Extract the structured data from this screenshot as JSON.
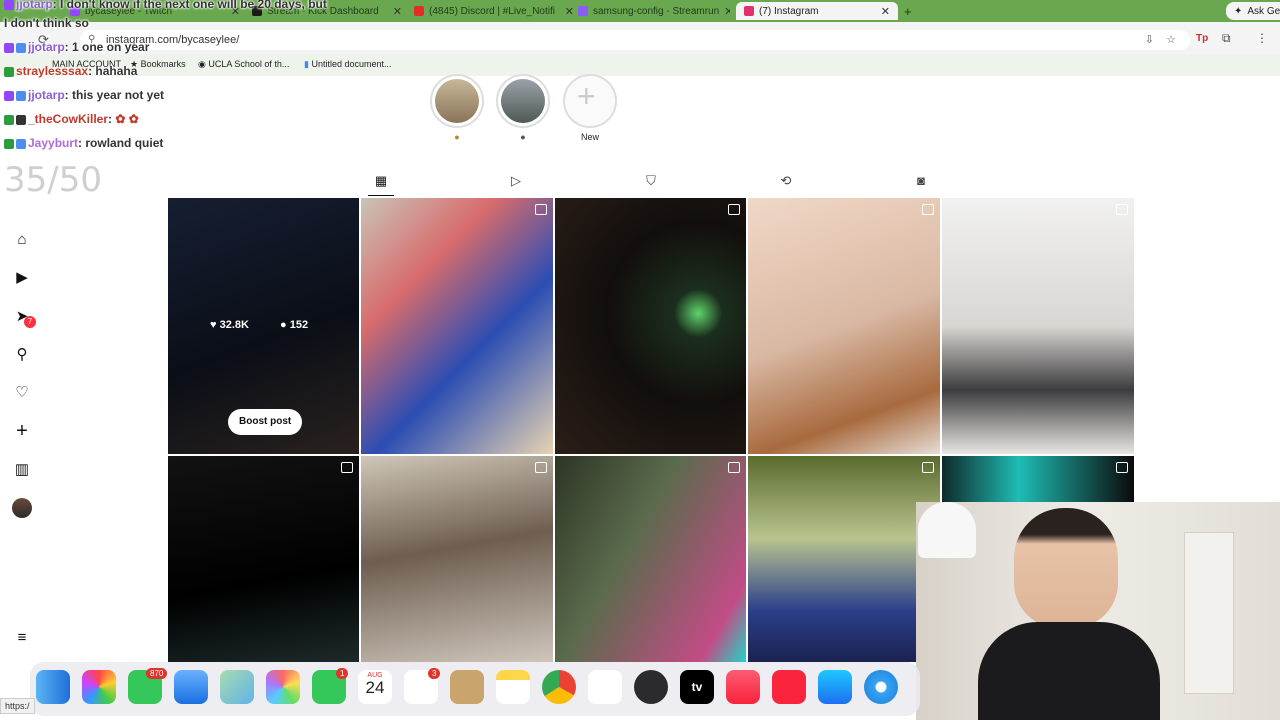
{
  "tabs": [
    {
      "label": "bycaseylee - Twitch",
      "color": "#9146ff"
    },
    {
      "label": "Stream - Kick Dashboard",
      "color": "#53fc18"
    },
    {
      "label": "(4845) Discord | #Live_Notifi",
      "color": "#5865f2"
    },
    {
      "label": "samsung-config - Streamrun",
      "color": "#8b5cf6"
    },
    {
      "label": "(7) Instagram",
      "color": "#e1306c"
    }
  ],
  "new_tab": "+",
  "ask_gemini": "Ask Gem",
  "url": "instagram.com/bycaseylee/",
  "bookmarks": {
    "main_account": "MAIN ACCOUNT",
    "bookmarks": "Bookmarks",
    "ucla": "UCLA School of th...",
    "untitled": "Untitled document..."
  },
  "chat": [
    {
      "user": "jjotarp",
      "text": ": I don't know if the next one will be 20 days, but"
    },
    {
      "user": "",
      "text": "I don't think so"
    },
    {
      "user": "jjotarp",
      "text": ": 1 one on year"
    },
    {
      "user": "straylesssax",
      "text": ": hahaha"
    },
    {
      "user": "jjotarp",
      "text": ": this year not yet"
    },
    {
      "user": "_theCowKiller",
      "text": ":"
    },
    {
      "user": "Jayyburt",
      "text": ": rowland quiet"
    }
  ],
  "counter": "35/50",
  "highlights": [
    {
      "label": ""
    },
    {
      "label": ""
    },
    {
      "label": "New"
    }
  ],
  "post_overlay": {
    "likes": "32.8K",
    "comments": "152",
    "boost": "Boost post"
  },
  "notif_count": "7",
  "dock": {
    "messages_badge": "870",
    "facetime_badge": "1",
    "reminders_badge": "3",
    "calendar_month": "AUG",
    "calendar_day": "24",
    "tv_label": "tv"
  },
  "status_url": "https:/"
}
